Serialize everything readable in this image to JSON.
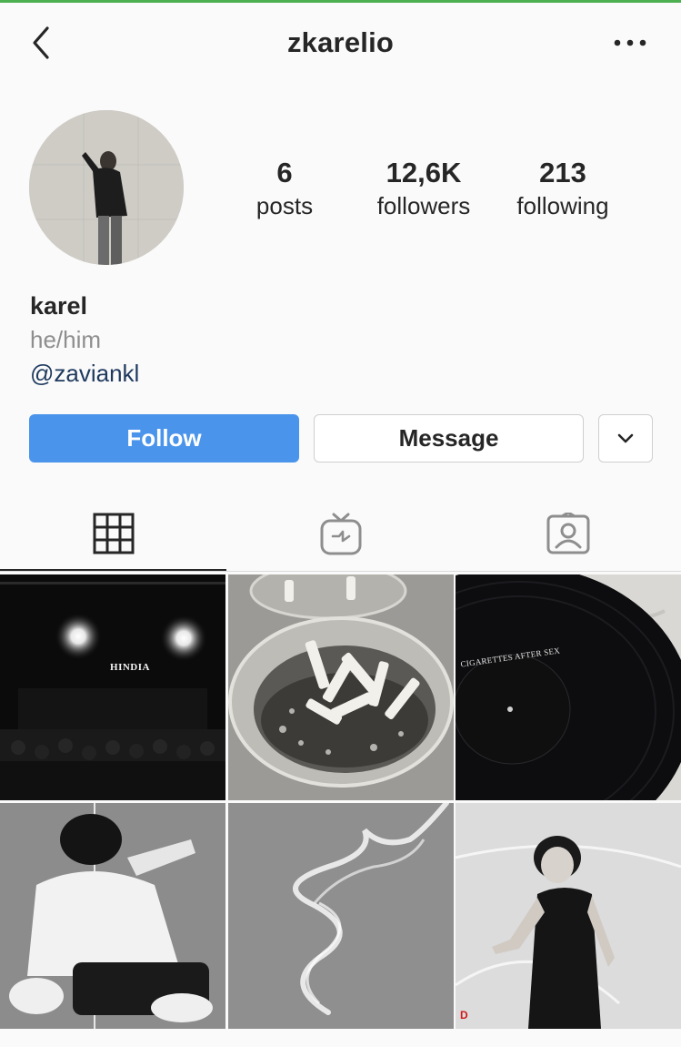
{
  "header": {
    "username": "zkarelio",
    "back_icon": "chevron-left-icon",
    "more_icon": "more-horizontal-icon"
  },
  "profile": {
    "avatar_icon": "profile-photo",
    "stats": [
      {
        "value": "6",
        "label": "posts"
      },
      {
        "value": "12,6K",
        "label": "followers"
      },
      {
        "value": "213",
        "label": "following"
      }
    ],
    "name": "karel",
    "pronouns": "he/him",
    "mention": "@zaviankl"
  },
  "actions": {
    "follow_label": "Follow",
    "message_label": "Message",
    "dropdown_icon": "chevron-down-icon"
  },
  "tabs": [
    {
      "icon": "grid-icon",
      "active": true
    },
    {
      "icon": "igtv-icon",
      "active": false
    },
    {
      "icon": "tagged-icon",
      "active": false
    }
  ],
  "posts": [
    {
      "id": "concert",
      "overlay_text": "HINDIA"
    },
    {
      "id": "ashtray"
    },
    {
      "id": "vinyl",
      "overlay_text": "CIGARETTES AFTER SEX"
    },
    {
      "id": "sitting-portrait"
    },
    {
      "id": "smoke"
    },
    {
      "id": "basketball",
      "overlay_text": "D"
    }
  ],
  "colors": {
    "follow_button": "#4a94eb",
    "mention_link": "#1f3a5f",
    "top_accent": "#4caf50"
  }
}
